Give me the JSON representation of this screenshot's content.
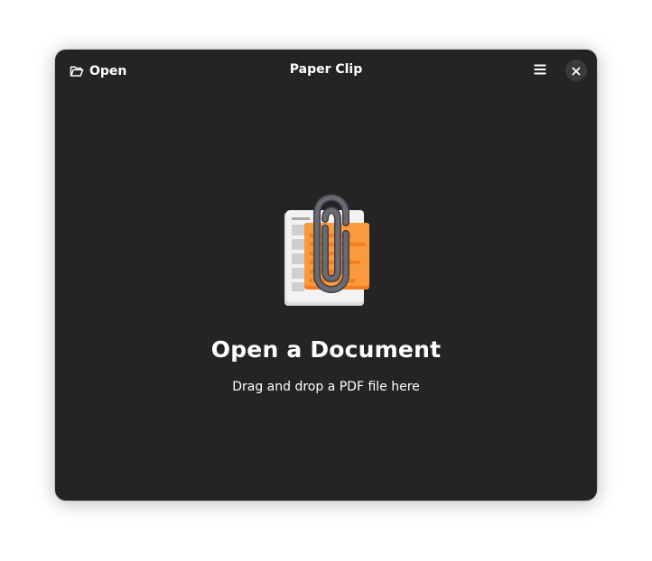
{
  "window": {
    "title": "Paper Clip"
  },
  "header": {
    "open_label": "Open",
    "open_icon": "folder-open-icon",
    "menu_icon": "hamburger-menu-icon",
    "close_icon": "close-icon"
  },
  "status_page": {
    "icon": "paper-clip-app-icon",
    "title": "Open a Document",
    "description": "Drag and drop a PDF file here"
  },
  "colors": {
    "window_bg": "#242424",
    "text": "#ffffff",
    "close_button_bg": "#3a3a3a",
    "accent_orange": "#f57c1f",
    "clip_gray": "#5a5a60"
  }
}
